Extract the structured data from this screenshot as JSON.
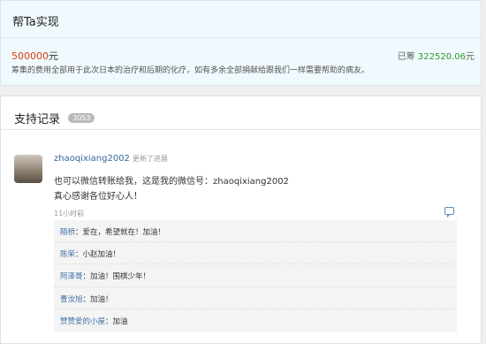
{
  "project": {
    "title": "帮Ta实现",
    "goal_amount": "500000",
    "goal_unit": "元",
    "raised_label": "已筹",
    "raised_amount": "322520.06",
    "raised_unit": "元",
    "description": "筹集的费用全部用于此次日本的治疗和后期的化疗，如有多余全部捐献给跟我们一样需要帮助的病友。"
  },
  "records": {
    "title": "支持记录",
    "count": "3053",
    "post": {
      "username": "zhaoqixiang2002",
      "action": "更新了进展",
      "line1": "也可以微信转账给我，这是我的微信号：zhaoqixiang2002",
      "line2": "真心感谢各位好心人！",
      "time": "11小时前",
      "replies": [
        {
          "name": "陌桥",
          "text": "爱在，希望就在！加油！"
        },
        {
          "name": "陈荣",
          "text": "小赵加油！"
        },
        {
          "name": "阿泽哥",
          "text": "加油！围棋少年！"
        },
        {
          "name": "曹汝旭",
          "text": "加油！"
        },
        {
          "name": "赞赞爱的小屋",
          "text": "加油"
        }
      ]
    }
  },
  "icons": {
    "reply": "comment-icon",
    "avatar": "user-avatar"
  },
  "colors": {
    "goal": "#e03a12",
    "raised": "#2a9d2a",
    "link": "#3d6fa5"
  }
}
